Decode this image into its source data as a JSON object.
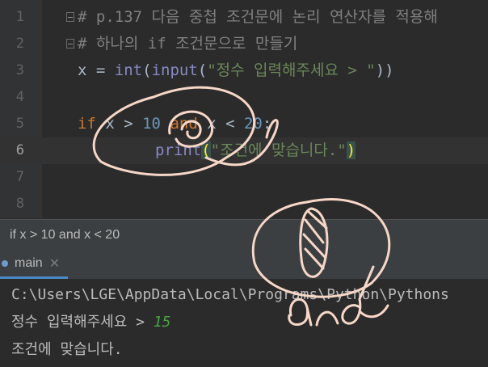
{
  "editor": {
    "lines": [
      {
        "num": "1",
        "comment": "# p.137 다음 중첩 조건문에 논리 연산자를 적용해"
      },
      {
        "num": "2",
        "comment": "# 하나의 if 조건문으로 만들기"
      },
      {
        "num": "3",
        "var": "x",
        "eq": " = ",
        "fn1": "int",
        "p1": "(",
        "fn2": "input",
        "p2": "(",
        "str": "\"정수 입력해주세요 > \"",
        "p3": "))"
      },
      {
        "num": "4"
      },
      {
        "num": "5",
        "kw_if": "if",
        "x1": " x > ",
        "n1": "10",
        "sp": " ",
        "kw_and": "and",
        "x2": " x < ",
        "n2": "20",
        "colon": ":"
      },
      {
        "num": "6",
        "fn": "print",
        "p_open": "(",
        "str": "\"조건에 맞습니다.\"",
        "p_close": ")"
      },
      {
        "num": "7"
      },
      {
        "num": "8"
      }
    ]
  },
  "status_hint": "if x > 10 and x < 20",
  "run_panel": {
    "tab_label": "main",
    "close_glyph": "✕"
  },
  "console": {
    "path": "C:\\Users\\LGE\\AppData\\Local\\Programs\\Python\\Pythons",
    "prompt": "정수 입력해주세요 > ",
    "input_value": "15",
    "output": "조건에 맞습니다."
  },
  "annotation": {
    "handwritten_text": "and",
    "stroke_color": "#f6d7c8"
  }
}
